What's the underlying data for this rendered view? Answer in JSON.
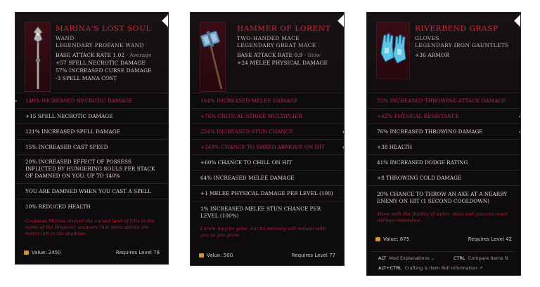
{
  "cards": [
    {
      "name": "Marina's Lost Soul",
      "type": "Wand",
      "rarity": "Legendary Profane Wand",
      "base_label": "Base Attack Rate 1.02",
      "base_note": " - Average",
      "implicits": [
        "+57 Spell Necrotic Damage",
        "57% Increased Curse Damage",
        "-3 Spell Mana Cost"
      ],
      "affixes": [
        {
          "text": "148% Increased Necrotic Damage",
          "red": true
        },
        {
          "text": "+15 Spell Necrotic Damage",
          "red": false
        },
        {
          "text": "121% Increased Spell Damage",
          "red": false
        },
        {
          "text": "15% Increased Cast Speed",
          "red": false
        },
        {
          "text": "20% Increased Effect of Possess Inflicted by Hungering Souls per stack of Damned on you, up to 140%",
          "red": false
        },
        {
          "text": "You are Damned when you cast a spell",
          "red": false
        },
        {
          "text": "10% Reduced Health",
          "red": false
        }
      ],
      "lore": "Countess Marina revived the cursed land of Ultx in the name of the Emperor, unaware that some spirits are better left in the shadows.",
      "value": "Value: 2450",
      "requires": "Requires Level 78"
    },
    {
      "name": "Hammer of Lorent",
      "type": "Two-Handed Mace",
      "rarity": "Legendary Great Mace",
      "base_label": "Base Attack Rate 0.9",
      "base_note": " - Slow",
      "implicits": [
        "+24 Melee Physical Damage"
      ],
      "affixes": [
        {
          "text": "164% Increased Melee Damage",
          "red": true
        },
        {
          "text": "+76% Critical Strike Multiplier",
          "red": true
        },
        {
          "text": "224% Increased Stun Chance",
          "red": true
        },
        {
          "text": "+248% Chance to Shred Armour on Hit",
          "red": true
        },
        {
          "text": "+60% Chance to Chill on Hit",
          "red": false
        },
        {
          "text": "64% Increased Melee Damage",
          "red": false
        },
        {
          "text": "+1 Melee Physical Damage per level (100)",
          "red": false
        },
        {
          "text": "1% Increased Melee Stun chance per level (100%)",
          "red": false
        }
      ],
      "lore": "Lorent may be gone, but its memory will remain with you as you grow.",
      "value": "Value: 500",
      "requires": "Requires Level 77"
    },
    {
      "name": "Riverbend Grasp",
      "type": "Gloves",
      "rarity": "Legendary Iron Gauntlets",
      "implicits": [
        "+36 Armor"
      ],
      "affixes": [
        {
          "text": "55% Increased Throwing Attack Damage",
          "red": true
        },
        {
          "text": "+42% Physical Resistance",
          "red": true
        },
        {
          "text": "76% Increased Throwing Damage",
          "red": false
        },
        {
          "text": "+38 Health",
          "red": false
        },
        {
          "text": "41% Increased Dodge Rating",
          "red": false
        },
        {
          "text": "+8 Throwing Cold Damage",
          "red": false
        },
        {
          "text": "20% Chance to Throw an Axe at a nearby enemy on hit (1 second cooldown)",
          "red": false
        }
      ],
      "lore": "Move with the fluidity of water, relax and you can react without resistance.",
      "value": "Value: 875",
      "requires": "Requires Level 42"
    }
  ],
  "keybar": {
    "alt": "ALT",
    "alt_text": "Mod Explanations ⌄",
    "ctrl": "CTRL",
    "ctrl_text": "Compare Items ⇅",
    "altctrl": "ALT+CTRL",
    "altctrl_text": "Crafting & Item Roll Information ↗"
  },
  "colors": {
    "accent_red": "#d3263f",
    "affix_red": "#c9234a",
    "panel": "#0d0b0e",
    "coin": "#c9992e"
  },
  "icons": [
    "wand-icon",
    "mace-icon",
    "gauntlets-icon",
    "coin-icon"
  ]
}
